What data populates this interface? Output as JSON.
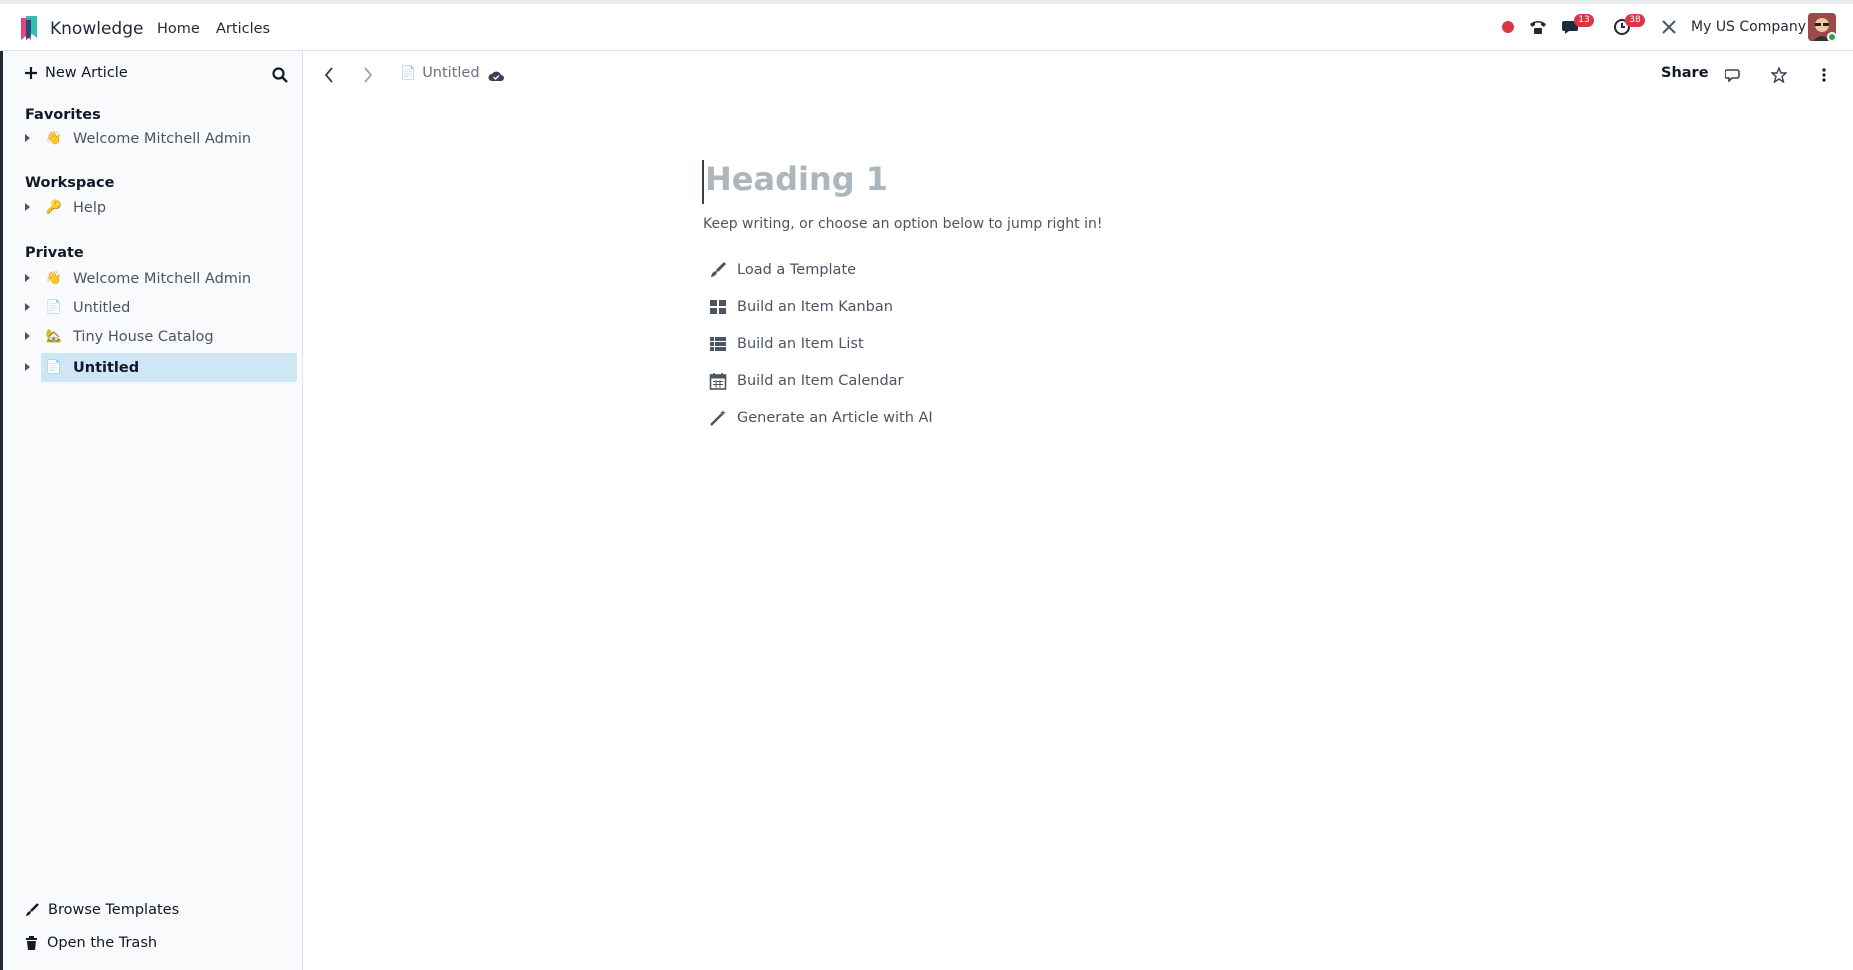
{
  "navbar": {
    "app_name": "Knowledge",
    "menu": [
      "Home",
      "Articles"
    ],
    "icons": [
      "record-dot-icon",
      "phone-icon",
      "chat-icon",
      "clock-activity-icon",
      "tools-icon"
    ],
    "messages_badge": "13",
    "activity_badge": "38",
    "company": "My US Company",
    "colors": {
      "record": "#dc3545",
      "badge": "#dc3545"
    }
  },
  "sidebar": {
    "new_article": "New Article",
    "favorites": {
      "title": "Favorites",
      "items": [
        {
          "emoji": "👋",
          "label": "Welcome Mitchell Admin"
        }
      ]
    },
    "workspace": {
      "title": "Workspace",
      "items": [
        {
          "emoji": "🔑",
          "label": "Help"
        }
      ]
    },
    "private": {
      "title": "Private",
      "items": [
        {
          "emoji": "👋",
          "label": "Welcome Mitchell Admin"
        },
        {
          "emoji": "📄",
          "label": "Untitled"
        },
        {
          "emoji": "🏡",
          "label": "Tiny House Catalog"
        },
        {
          "emoji": "📄",
          "label": "Untitled",
          "active": true
        }
      ]
    },
    "footer": {
      "browse_templates": "Browse Templates",
      "open_trash": "Open the Trash"
    },
    "colors": {
      "active_bg": "#cfe6f5"
    }
  },
  "toolbar": {
    "breadcrumb_emoji": "📄",
    "breadcrumb": "Untitled",
    "share": "Share"
  },
  "editor": {
    "heading_placeholder": "Heading 1",
    "hint": "Keep writing, or choose an option below to jump right in!",
    "commands": [
      {
        "icon": "paint-brush-icon",
        "label": "Load a Template"
      },
      {
        "icon": "kanban-grid-icon",
        "label": "Build an Item Kanban"
      },
      {
        "icon": "list-icon",
        "label": "Build an Item List"
      },
      {
        "icon": "calendar-icon",
        "label": "Build an Item Calendar"
      },
      {
        "icon": "magic-wand-icon",
        "label": "Generate an Article with AI"
      }
    ]
  }
}
